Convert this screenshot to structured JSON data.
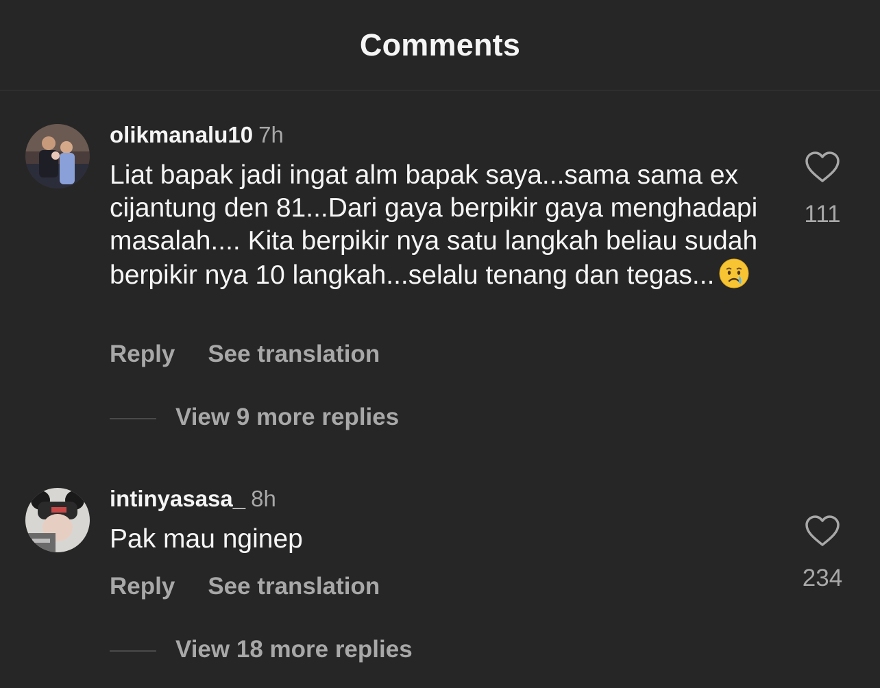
{
  "header": {
    "title": "Comments"
  },
  "comments": [
    {
      "username": "olikmanalu10",
      "time": "7h",
      "text": "Liat bapak jadi ingat alm bapak saya...sama sama ex cijantung den 81...Dari gaya berpikir gaya menghadapi masalah.... Kita berpikir nya satu langkah beliau sudah berpikir nya 10 langkah...selalu tenang dan tegas...",
      "emoji": "crying-face",
      "reply_label": "Reply",
      "translation_label": "See translation",
      "likes": "111",
      "view_replies": "View 9 more replies"
    },
    {
      "username": "intinyasasa_",
      "time": "8h",
      "text": "Pak mau nginep",
      "reply_label": "Reply",
      "translation_label": "See translation",
      "likes": "234",
      "view_replies": "View 18 more replies"
    }
  ],
  "colors": {
    "background": "#262626",
    "primary_text": "#f5f5f5",
    "secondary_text": "#a8a8a8",
    "divider": "#3a3a3a"
  },
  "icons": {
    "like": "heart-outline-icon",
    "emoji": "crying-face-emoji"
  }
}
